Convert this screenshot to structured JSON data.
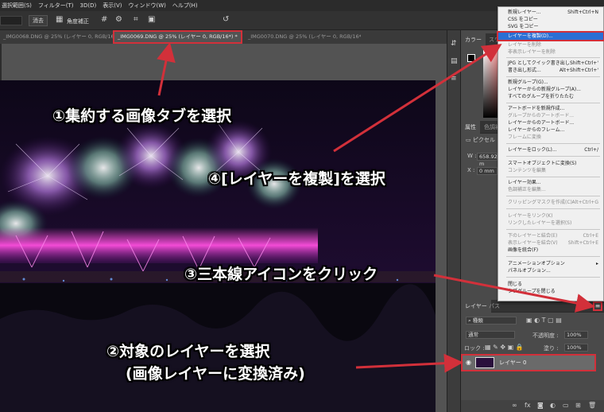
{
  "menubar": {
    "items": [
      "選択範囲(S)",
      "フィルター(T)",
      "3D(D)",
      "表示(V)",
      "ウィンドウ(W)",
      "ヘルプ(H)"
    ]
  },
  "optionsbar": {
    "erase": "消去",
    "straighten": "角度補正"
  },
  "tabs": [
    {
      "label": "_IMG0068.DNG @ 25% (レイヤー 0, RGB/16*) *"
    },
    {
      "label": "_IMG0069.DNG @ 25% (レイヤー 0, RGB/16*) *"
    },
    {
      "label": "_IMG0070.DNG @ 25% (レイヤー 0, RGB/16*) *"
    }
  ],
  "color_panel": {
    "tab1": "カラー",
    "tab2": "スウ"
  },
  "properties": {
    "tab1": "属性",
    "tab2": "色調補",
    "kind": "ピクセル",
    "w_label": "W :",
    "w_value": "658.92 m",
    "x_label": "X :",
    "x_value": "0 mm"
  },
  "layers_panel": {
    "tab1": "レイヤー",
    "tab2": "パス",
    "filter_label": "種類",
    "blend_mode": "通常",
    "opacity_label": "不透明度 :",
    "opacity_value": "100%",
    "lock_label": "ロック :",
    "fill_label": "塗り :",
    "fill_value": "100%",
    "layer_name": "レイヤー 0"
  },
  "context_menu": {
    "items": [
      {
        "label": "新規レイヤー...",
        "shortcut": "Shift+Ctrl+N",
        "disabled": false
      },
      {
        "label": "CSS をコピー",
        "shortcut": "",
        "disabled": false
      },
      {
        "label": "SVG をコピー",
        "shortcut": "",
        "disabled": false
      },
      {
        "label": "レイヤーを複製(D)...",
        "shortcut": "",
        "disabled": false,
        "highlighted": true
      },
      {
        "label": "レイヤーを削除",
        "shortcut": "",
        "disabled": true
      },
      {
        "label": "非表示レイヤーを削除",
        "shortcut": "",
        "disabled": true
      },
      {
        "label": "JPG としてクイック書き出し",
        "shortcut": "Shift+Ctrl+'",
        "disabled": false
      },
      {
        "label": "書き出し形式...",
        "shortcut": "Alt+Shift+Ctrl+'",
        "disabled": false
      },
      {
        "label": "新規グループ(G)...",
        "shortcut": "",
        "disabled": false
      },
      {
        "label": "レイヤーからの新規グループ(A)...",
        "shortcut": "",
        "disabled": false
      },
      {
        "label": "すべてのグループを折りたたむ",
        "shortcut": "",
        "disabled": false
      },
      {
        "label": "アートボードを新規作成...",
        "shortcut": "",
        "disabled": false
      },
      {
        "label": "グループからのアートボード...",
        "shortcut": "",
        "disabled": true
      },
      {
        "label": "レイヤーからのアートボード...",
        "shortcut": "",
        "disabled": false
      },
      {
        "label": "レイヤーからのフレーム...",
        "shortcut": "",
        "disabled": false
      },
      {
        "label": "フレームに変換",
        "shortcut": "",
        "disabled": true
      },
      {
        "label": "レイヤーをロック(L)...",
        "shortcut": "Ctrl+/",
        "disabled": false
      },
      {
        "label": "スマートオブジェクトに変換(S)",
        "shortcut": "",
        "disabled": false
      },
      {
        "label": "コンテンツを編集",
        "shortcut": "",
        "disabled": true
      },
      {
        "label": "レイヤー効果...",
        "shortcut": "",
        "disabled": false
      },
      {
        "label": "色調補正を編集...",
        "shortcut": "",
        "disabled": true
      },
      {
        "label": "クリッピングマスクを作成(C)",
        "shortcut": "Alt+Ctrl+G",
        "disabled": true
      },
      {
        "label": "レイヤーをリンク(K)",
        "shortcut": "",
        "disabled": true
      },
      {
        "label": "リンクしたレイヤーを選択(S)",
        "shortcut": "",
        "disabled": true
      },
      {
        "label": "下のレイヤーと結合(E)",
        "shortcut": "Ctrl+E",
        "disabled": true
      },
      {
        "label": "表示レイヤーを結合(V)",
        "shortcut": "Shift+Ctrl+E",
        "disabled": true
      },
      {
        "label": "画像を統合(F)",
        "shortcut": "",
        "disabled": false
      },
      {
        "label": "アニメーションオプション",
        "shortcut": "",
        "disabled": false
      },
      {
        "label": "パネルオプション...",
        "shortcut": "",
        "disabled": false
      },
      {
        "label": "閉じる",
        "shortcut": "",
        "disabled": false
      },
      {
        "label": "タブグループを閉じる",
        "shortcut": "",
        "disabled": false
      }
    ]
  },
  "annotations": {
    "a1": "①集約する画像タブを選択",
    "a4": "④[レイヤーを複製]を選択",
    "a3": "③三本線アイコンをクリック",
    "a2_line1": "②対象のレイヤーを選択",
    "a2_line2": "(画像レイヤーに変換済み)"
  },
  "colors": {
    "highlight": "#d2303a",
    "menu_selection": "#2b6fd4"
  }
}
